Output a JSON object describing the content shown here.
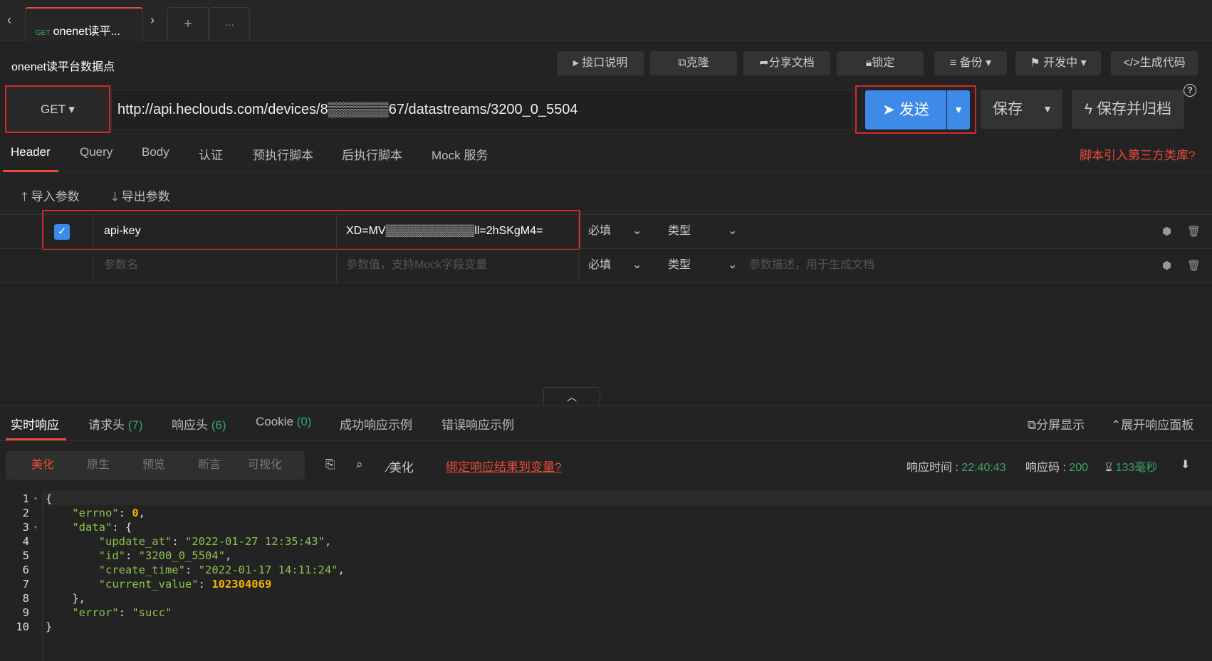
{
  "tab": {
    "method": "GET",
    "title": "onenet读平...",
    "add": "+",
    "more": "···"
  },
  "header": {
    "title": "onenet读平台数据点",
    "buttons": {
      "doc": "接口说明",
      "clone": "克隆",
      "share": "分享文档",
      "lock": "锁定",
      "backup": "备份",
      "status": "开发中",
      "gen": "生成代码"
    }
  },
  "request": {
    "method": "GET",
    "url": "http://api.heclouds.com/devices/8▒▒▒▒▒▒67/datastreams/3200_0_5504",
    "send": "发送",
    "save": "保存",
    "save_archive": "保存并归档"
  },
  "req_tabs": [
    "Header",
    "Query",
    "Body",
    "认证",
    "预执行脚本",
    "后执行脚本",
    "Mock 服务"
  ],
  "third_party_link": "脚本引入第三方类库?",
  "import_params": "导入参数",
  "export_params": "导出参数",
  "params": [
    {
      "name": "api-key",
      "value": "XD=MV▒▒▒▒▒▒▒▒▒▒▒ll=2hSKgM4=",
      "required": "必填",
      "type": "类型",
      "desc": ""
    }
  ],
  "new_param": {
    "name_placeholder": "参数名",
    "value_placeholder": "参数值，支持Mock字段变量",
    "required": "必填",
    "type": "类型",
    "desc_placeholder": "参数描述，用于生成文档"
  },
  "resp_tabs": {
    "live": "实时响应",
    "req_headers": "请求头",
    "req_headers_count": "(7)",
    "resp_headers": "响应头",
    "resp_headers_count": "(6)",
    "cookie": "Cookie",
    "cookie_count": "(0)",
    "success_example": "成功响应示例",
    "error_example": "错误响应示例",
    "split": "分屏显示",
    "expand": "展开响应面板"
  },
  "view_modes": [
    "美化",
    "原生",
    "预览",
    "断言",
    "可视化"
  ],
  "tools": {
    "beautify": "美化",
    "bind": "绑定响应结果到变量?"
  },
  "stats": {
    "time_label": "响应时间 : ",
    "time": "22:40:43",
    "code_label": "响应码 : ",
    "code": "200",
    "duration": "133毫秒"
  },
  "response": {
    "errno": "0",
    "update_at": "\"2022-01-27 12:35:43\"",
    "id": "\"3200_0_5504\"",
    "create_time": "\"2022-01-17 14:11:24\"",
    "current_value": "102304069",
    "error": "\"succ\""
  },
  "colors": {
    "accent": "#e74c3c",
    "primary": "#3d8ae8",
    "success": "#3aa56a",
    "number": "#f5b400"
  }
}
